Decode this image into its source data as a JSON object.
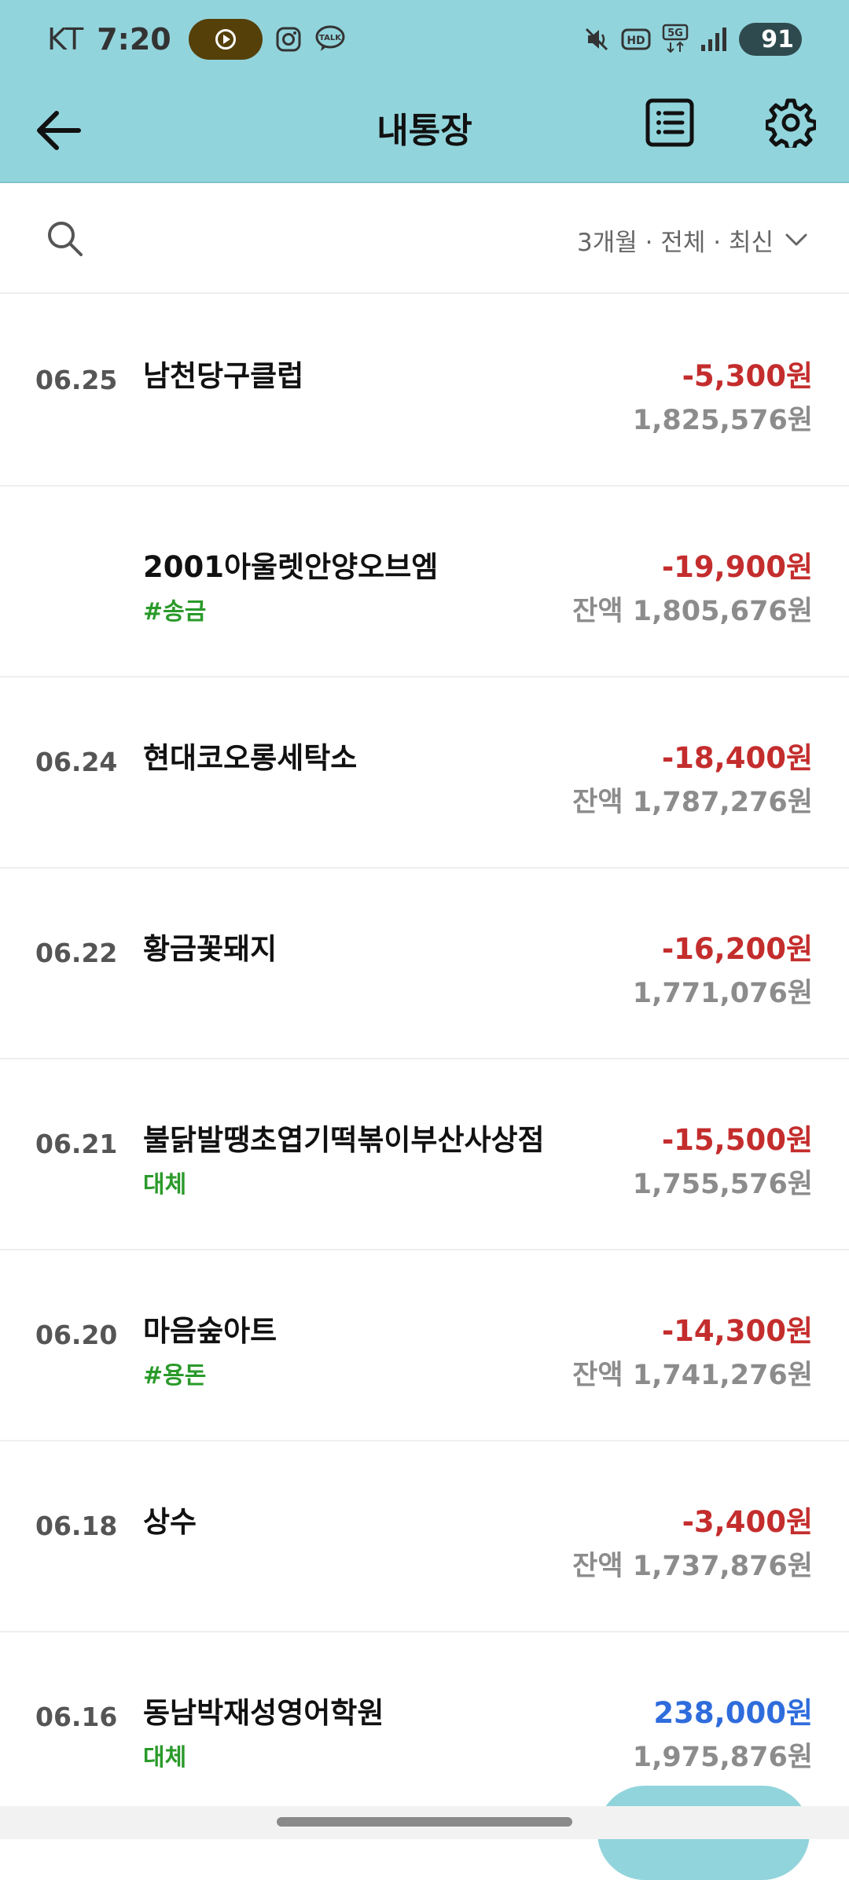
{
  "status_bar": {
    "carrier": "KT",
    "time": "7:20",
    "battery": "91",
    "icons": [
      "play-circle-icon",
      "instagram-icon",
      "kakaotalk-icon",
      "mute-icon",
      "hd-icon",
      "5g-icon",
      "signal-icon",
      "battery-icon"
    ],
    "talk_label": "TALK"
  },
  "header": {
    "title": "내통장",
    "accent_color": "#92d4dc"
  },
  "filter": {
    "label": "3개월 · 전체 · 최신"
  },
  "transactions": [
    {
      "date": "06.25",
      "name": "남천당구클럽",
      "tag": "",
      "amount": "-5,300원",
      "type": "withdrawal",
      "balance": "1,825,576원"
    },
    {
      "date": "",
      "name": "2001아울렛안양오브엠",
      "tag": "#송금",
      "amount": "-19,900원",
      "type": "withdrawal",
      "balance": "잔액 1,805,676원"
    },
    {
      "date": "06.24",
      "name": "현대코오롱세탁소",
      "tag": "",
      "amount": "-18,400원",
      "type": "withdrawal",
      "balance": "잔액 1,787,276원"
    },
    {
      "date": "06.22",
      "name": "황금꽃돼지",
      "tag": "",
      "amount": "-16,200원",
      "type": "withdrawal",
      "balance": "1,771,076원"
    },
    {
      "date": "06.21",
      "name": "불닭발땡초엽기떡볶이부산사상점",
      "tag": "대체",
      "amount": "-15,500원",
      "type": "withdrawal",
      "balance": "1,755,576원"
    },
    {
      "date": "06.20",
      "name": "마음숲아트",
      "tag": "#용돈",
      "amount": "-14,300원",
      "type": "withdrawal",
      "balance": "잔액 1,741,276원"
    },
    {
      "date": "06.18",
      "name": "상수",
      "tag": "",
      "amount": "-3,400원",
      "type": "withdrawal",
      "balance": "잔액 1,737,876원"
    },
    {
      "date": "06.16",
      "name": "동남박재성영어학원",
      "tag": "대체",
      "amount": "238,000원",
      "type": "deposit",
      "balance": "1,975,876원"
    }
  ]
}
